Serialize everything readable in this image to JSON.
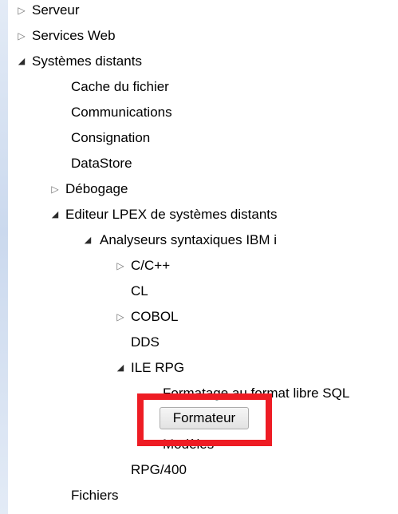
{
  "tree": {
    "items": [
      {
        "label": "Serveur"
      },
      {
        "label": "Services Web"
      },
      {
        "label": "Systèmes distants"
      },
      {
        "label": "Cache du fichier"
      },
      {
        "label": "Communications"
      },
      {
        "label": "Consignation"
      },
      {
        "label": "DataStore"
      },
      {
        "label": "Débogage"
      },
      {
        "label": "Editeur LPEX de systèmes distants"
      },
      {
        "label": "Analyseurs syntaxiques IBM i"
      },
      {
        "label": "C/C++"
      },
      {
        "label": "CL"
      },
      {
        "label": "COBOL"
      },
      {
        "label": "DDS"
      },
      {
        "label": "ILE RPG"
      },
      {
        "label": "Formatage au format libre SQL"
      },
      {
        "label": "Modèles"
      },
      {
        "label": "RPG/400"
      },
      {
        "label": "Fichiers"
      }
    ]
  },
  "button": {
    "label": "Formateur"
  },
  "icons": {
    "collapsed": "▷",
    "expanded": "◢"
  },
  "colors": {
    "highlight": "#ee1c24"
  }
}
